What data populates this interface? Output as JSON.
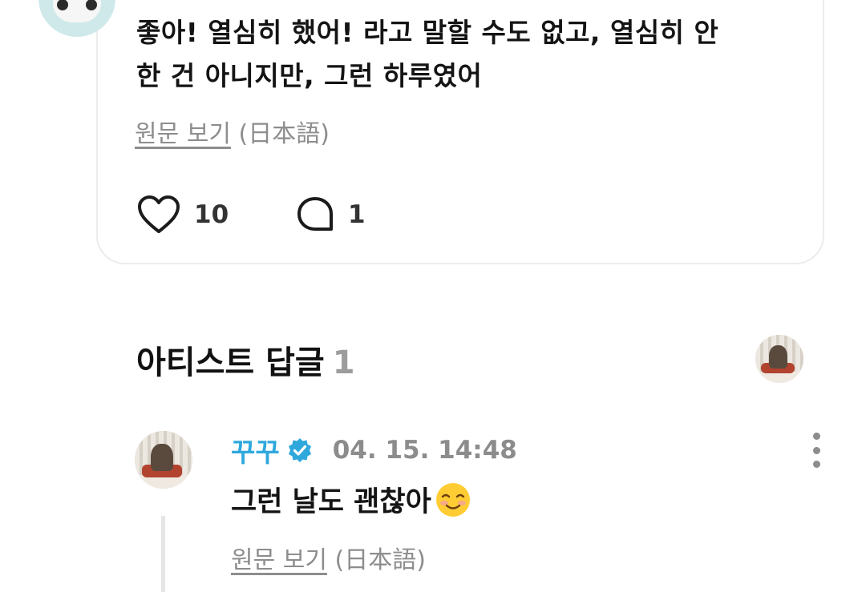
{
  "post": {
    "text_line1": "좋아! 열심히 했어! 라고 말할 수도 없고, 열심히 안",
    "text_line2": "한 건 아니지만, 그런 하루였어",
    "translate_link": "원문 보기",
    "translate_lang": "(日本語)",
    "likes": "10",
    "comments": "1"
  },
  "artist_replies": {
    "title": "아티스트 답글",
    "count": "1"
  },
  "comment": {
    "author": "꾸꾸",
    "timestamp": "04. 15. 14:48",
    "text": "그런 날도 괜찮아",
    "translate_link": "원문 보기",
    "translate_lang": "(日本語)"
  },
  "colors": {
    "author": "#2fa8dd",
    "verified": "#2fa8dd",
    "muted": "#8c8c8c",
    "card_border": "#ececec"
  },
  "icons": [
    "heart-icon",
    "comment-bubble-icon",
    "verified-badge-icon",
    "more-vertical-icon",
    "smiling-face-emoji"
  ]
}
